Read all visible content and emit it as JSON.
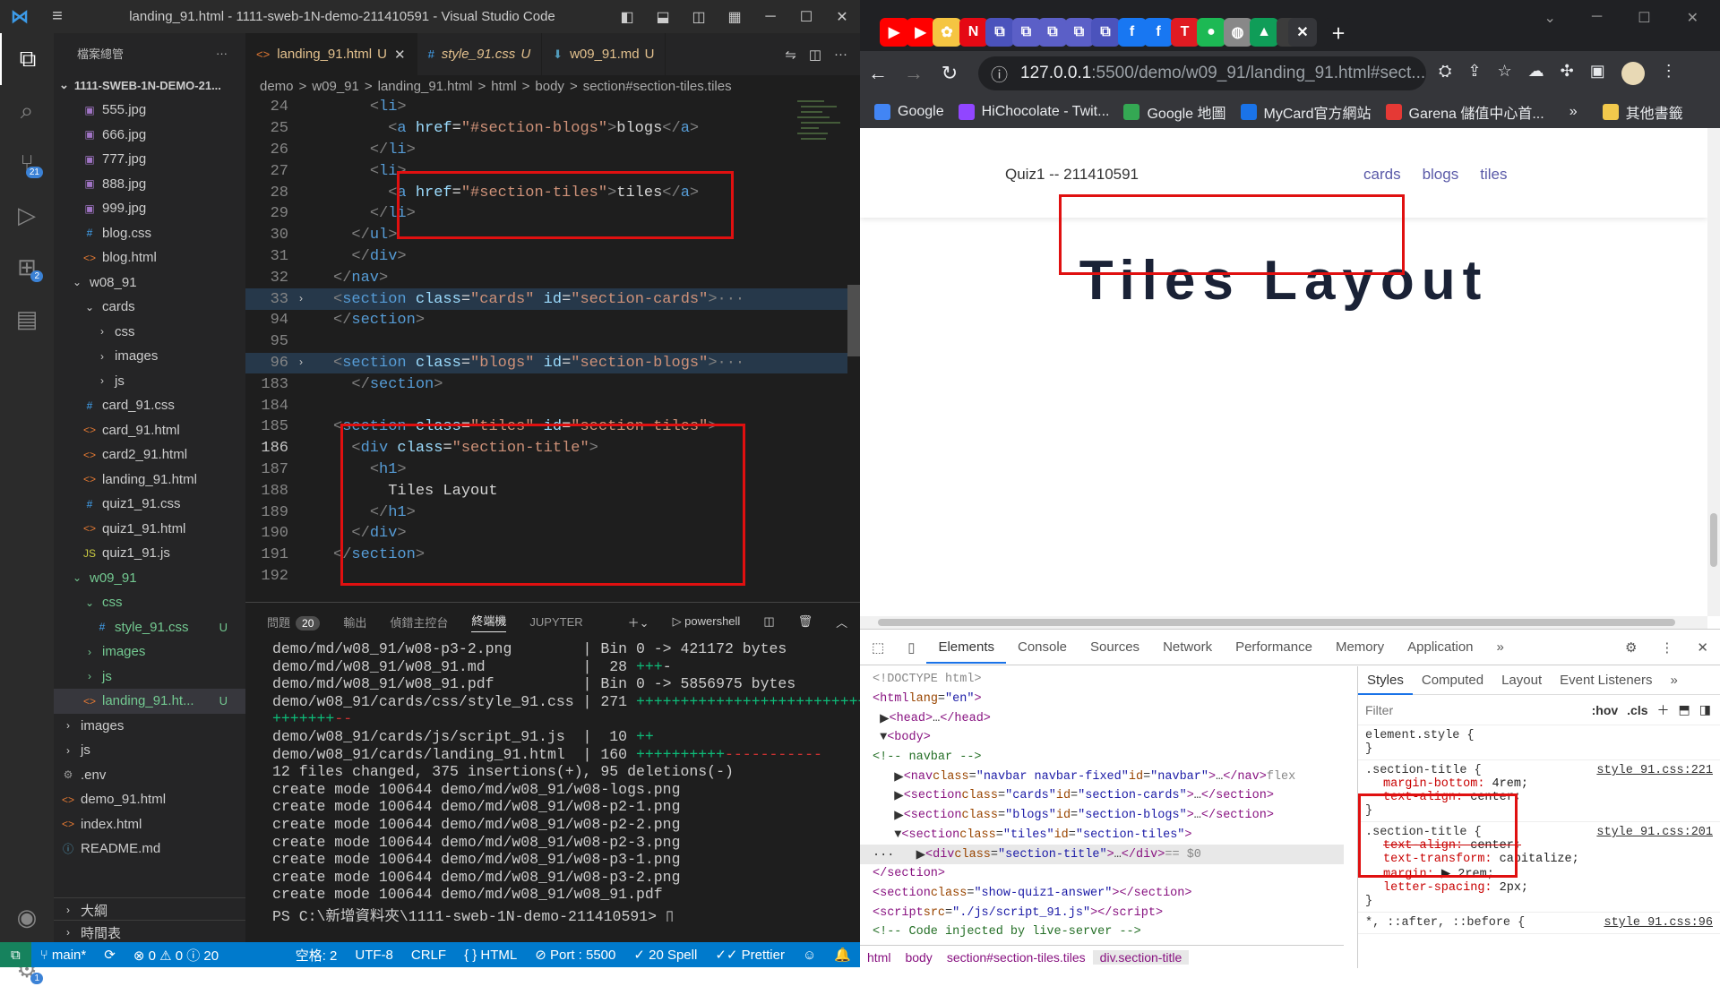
{
  "vscode": {
    "window_title": "landing_91.html - 1111-sweb-1N-demo-211410591 - Visual Studio Code",
    "activity": {
      "scm_badge": "21",
      "ext_badge": "2",
      "settings_badge": "1"
    },
    "explorer": {
      "header": "檔案總管",
      "more": "···",
      "root": "1111-SWEB-1N-DEMO-21...",
      "items": [
        {
          "label": "555.jpg",
          "icon": "img"
        },
        {
          "label": "666.jpg",
          "icon": "img"
        },
        {
          "label": "777.jpg",
          "icon": "img"
        },
        {
          "label": "888.jpg",
          "icon": "img"
        },
        {
          "label": "999.jpg",
          "icon": "img"
        },
        {
          "label": "blog.css",
          "icon": "css"
        },
        {
          "label": "blog.html",
          "icon": "html"
        },
        {
          "label": "w08_91",
          "icon": "folder-open"
        },
        {
          "label": "cards",
          "icon": "folder-open"
        },
        {
          "label": "css",
          "icon": "folder"
        },
        {
          "label": "images",
          "icon": "folder"
        },
        {
          "label": "js",
          "icon": "folder"
        },
        {
          "label": "card_91.css",
          "icon": "css"
        },
        {
          "label": "card_91.html",
          "icon": "html"
        },
        {
          "label": "card2_91.html",
          "icon": "html"
        },
        {
          "label": "landing_91.html",
          "icon": "html"
        },
        {
          "label": "quiz1_91.css",
          "icon": "css"
        },
        {
          "label": "quiz1_91.html",
          "icon": "html"
        },
        {
          "label": "quiz1_91.js",
          "icon": "js"
        },
        {
          "label": "w09_91",
          "icon": "folder-open"
        },
        {
          "label": "css",
          "icon": "folder-open"
        },
        {
          "label": "style_91.css",
          "icon": "css",
          "status": "U"
        },
        {
          "label": "images",
          "icon": "folder"
        },
        {
          "label": "js",
          "icon": "folder"
        },
        {
          "label": "landing_91.ht...",
          "icon": "html",
          "status": "U"
        },
        {
          "label": "images",
          "icon": "folder"
        },
        {
          "label": "js",
          "icon": "folder"
        },
        {
          "label": ".env",
          "icon": "env"
        },
        {
          "label": "demo_91.html",
          "icon": "html"
        },
        {
          "label": "index.html",
          "icon": "html"
        },
        {
          "label": "README.md",
          "icon": "md"
        }
      ],
      "outline": "大綱",
      "timeline": "時間表"
    },
    "tabs": [
      {
        "label": "landing_91.html",
        "status": "U"
      },
      {
        "label": "style_91.css",
        "status": "U"
      },
      {
        "label": "w09_91.md",
        "status": "U"
      }
    ],
    "breadcrumb": [
      "demo",
      ">",
      "w09_91",
      ">",
      "landing_91.html",
      ">",
      "html",
      ">",
      "body",
      ">",
      "section#section-tiles.tiles"
    ],
    "code_lines": [
      {
        "ln": "24",
        "html": "    <span class='pu'>&lt;</span><span class='tg'>li</span><span class='pu'>&gt;</span>"
      },
      {
        "ln": "25",
        "html": "      <span class='pu'>&lt;</span><span class='tg'>a</span> <span class='at'>href</span>=<span class='sv'>\"#section-blogs\"</span><span class='pu'>&gt;</span>blogs<span class='pu'>&lt;/</span><span class='tg'>a</span><span class='pu'>&gt;</span>"
      },
      {
        "ln": "26",
        "html": "    <span class='pu'>&lt;/</span><span class='tg'>li</span><span class='pu'>&gt;</span>"
      },
      {
        "ln": "27",
        "html": "    <span class='pu'>&lt;</span><span class='tg'>li</span><span class='pu'>&gt;</span>"
      },
      {
        "ln": "28",
        "html": "      <span class='pu'>&lt;</span><span class='tg'>a</span> <span class='at'>href</span>=<span class='sv'>\"#section-tiles\"</span><span class='pu'>&gt;</span>tiles<span class='pu'>&lt;/</span><span class='tg'>a</span><span class='pu'>&gt;</span>"
      },
      {
        "ln": "29",
        "html": "    <span class='pu'>&lt;/</span><span class='tg'>li</span><span class='pu'>&gt;</span>"
      },
      {
        "ln": "30",
        "html": "  <span class='pu'>&lt;/</span><span class='tg'>ul</span><span class='pu'>&gt;</span>"
      },
      {
        "ln": "31",
        "html": "  <span class='pu'>&lt;/</span><span class='tg'>div</span><span class='pu'>&gt;</span>"
      },
      {
        "ln": "32",
        "html": "<span class='pu'>&lt;/</span><span class='tg'>nav</span><span class='pu'>&gt;</span>"
      },
      {
        "ln": "33",
        "html": "<span class='pu'>&lt;</span><span class='tg'>section</span> <span class='at'>class</span>=<span class='sv'>\"cards\"</span> <span class='at'>id</span>=<span class='sv'>\"section-cards\"</span><span class='pu'>&gt;</span><span class='pu'>···</span>",
        "fold": "›",
        "hl": true
      },
      {
        "ln": "94",
        "html": "<span class='pu'>&lt;/</span><span class='tg'>section</span><span class='pu'>&gt;</span>"
      },
      {
        "ln": "95",
        "html": ""
      },
      {
        "ln": "96",
        "html": "<span class='pu'>&lt;</span><span class='tg'>section</span> <span class='at'>class</span>=<span class='sv'>\"blogs\"</span> <span class='at'>id</span>=<span class='sv'>\"section-blogs\"</span><span class='pu'>&gt;</span><span class='pu'>···</span>",
        "fold": "›",
        "hl": true
      },
      {
        "ln": "183",
        "html": "  <span class='pu'>&lt;/</span><span class='tg'>section</span><span class='pu'>&gt;</span>"
      },
      {
        "ln": "184",
        "html": ""
      },
      {
        "ln": "185",
        "html": "<span class='pu'>&lt;</span><span class='tg'>section</span> <span class='at'>class</span>=<span class='sv'>\"tiles\"</span> <span class='at'>id</span>=<span class='sv'>\"section-tiles\"</span><span class='pu'>&gt;</span>"
      },
      {
        "ln": "186",
        "html": "  <span class='pu'>&lt;</span><span class='tg'>div</span> <span class='at'>class</span>=<span class='sv'>\"section-title\"</span><span class='pu'>&gt;</span>",
        "cur": true
      },
      {
        "ln": "187",
        "html": "    <span class='pu'>&lt;</span><span class='tg'>h1</span><span class='pu'>&gt;</span>"
      },
      {
        "ln": "188",
        "html": "      Tiles Layout"
      },
      {
        "ln": "189",
        "html": "    <span class='pu'>&lt;/</span><span class='tg'>h1</span><span class='pu'>&gt;</span>"
      },
      {
        "ln": "190",
        "html": "  <span class='pu'>&lt;/</span><span class='tg'>div</span><span class='pu'>&gt;</span>"
      },
      {
        "ln": "191",
        "html": "<span class='pu'>&lt;/</span><span class='tg'>section</span><span class='pu'>&gt;</span>"
      },
      {
        "ln": "192",
        "html": ""
      }
    ],
    "panel": {
      "tabs": [
        "問題",
        "輸出",
        "偵錯主控台",
        "終端機",
        "JUPYTER"
      ],
      "problem_count": "20",
      "shell": "powershell",
      "terminal": [
        {
          "html": "demo/md/w08_91/w08-p3-2.png        | Bin 0 -> 421172 bytes"
        },
        {
          "html": "demo/md/w08_91/w08_91.md           |  28 <span class='grn'>+++</span>-"
        },
        {
          "html": "demo/md/w08_91/w08_91.pdf          | Bin 0 -> 5856975 bytes"
        },
        {
          "html": "demo/w08_91/cards/css/style_91.css | 271 <span class='grn'>+++++++++++++++++++++++++++++++</span>"
        },
        {
          "html": "<span class='grn'>+++++++</span><span class='red'>--</span>"
        },
        {
          "html": "demo/w08_91/cards/js/script_91.js  |  10 <span class='grn'>++</span>"
        },
        {
          "html": "demo/w08_91/cards/landing_91.html  | 160 <span class='grn'>++++++++++</span><span class='red'>-----------</span>"
        },
        {
          "html": "12 files changed, 375 insertions(+), 95 deletions(-)"
        },
        {
          "html": "create mode 100644 demo/md/w08_91/w08-logs.png"
        },
        {
          "html": "create mode 100644 demo/md/w08_91/w08-p2-1.png"
        },
        {
          "html": "create mode 100644 demo/md/w08_91/w08-p2-2.png"
        },
        {
          "html": "create mode 100644 demo/md/w08_91/w08-p2-3.png"
        },
        {
          "html": "create mode 100644 demo/md/w08_91/w08-p3-1.png"
        },
        {
          "html": "create mode 100644 demo/md/w08_91/w08-p3-2.png"
        },
        {
          "html": "create mode 100644 demo/md/w08_91/w08_91.pdf"
        },
        {
          "html": "PS C:\\新增資料夾\\1111-sweb-1N-demo-211410591> ▯"
        }
      ]
    },
    "status": {
      "branch": "main*",
      "sync": "⟳",
      "problems": "⊗ 0 ⚠ 0 ⓘ 20",
      "spaces": "空格: 2",
      "encoding": "UTF-8",
      "eol": "CRLF",
      "language": "{ } HTML",
      "port": "⊘ Port : 5500",
      "spell": "✓ 20 Spell",
      "prettier": "✓✓ Prettier"
    }
  },
  "chrome": {
    "tab_colors": [
      "#ff0000",
      "#ff0000",
      "#f5c542",
      "#e50914",
      "#4b53bc",
      "#5b5fc7",
      "#5b5fc7",
      "#5b5fc7",
      "#4b53bc",
      "#1877f2",
      "#1877f2",
      "#e01b22",
      "#1db954",
      "#888888",
      "#0f9d58",
      "#3c3c3c"
    ],
    "url_host": "127.0.0.1",
    "url_path": ":5500/demo/w09_91/landing_91.html#sect...",
    "bookmarks": [
      {
        "label": "Google",
        "color": "#4285f4"
      },
      {
        "label": "HiChocolate - Twit...",
        "color": "#9146ff"
      },
      {
        "label": "Google 地圖",
        "color": "#34a853"
      },
      {
        "label": "MyCard官方網站",
        "color": "#1a73e8"
      },
      {
        "label": "Garena 儲值中心首...",
        "color": "#e53935"
      }
    ],
    "bookmarks_more": "»",
    "other_bookmarks": "其他書籤",
    "page": {
      "brand": "Quiz1 -- 211410591",
      "nav_links": [
        "cards",
        "blogs",
        "tiles"
      ],
      "heading": "Tiles Layout"
    },
    "devtools": {
      "tabs": [
        "Elements",
        "Console",
        "Sources",
        "Network",
        "Performance",
        "Memory",
        "Application",
        "»"
      ],
      "elements": [
        {
          "html": "<span class='eg'>&lt;!DOCTYPE html&gt;</span>"
        },
        {
          "html": "<span class='et'>&lt;html</span> <span class='ea'>lang</span>=<span class='ev'>\"en\"</span><span class='et'>&gt;</span>"
        },
        {
          "html": " ▶<span class='et'>&lt;head&gt;</span>…<span class='et'>&lt;/head&gt;</span>"
        },
        {
          "html": " ▼<span class='et'>&lt;body&gt;</span>"
        },
        {
          "html": "    <span class='ec'>&lt;!-- navbar --&gt;</span>"
        },
        {
          "html": "   ▶<span class='et'>&lt;nav</span> <span class='ea'>class</span>=<span class='ev'>\"navbar navbar-fixed\"</span> <span class='ea'>id</span>=<span class='ev'>\"navbar\"</span><span class='et'>&gt;</span>…<span class='et'>&lt;/nav&gt;</span> <span class='eg'>flex</span>"
        },
        {
          "html": "   ▶<span class='et'>&lt;section</span> <span class='ea'>class</span>=<span class='ev'>\"cards\"</span> <span class='ea'>id</span>=<span class='ev'>\"section-cards\"</span><span class='et'>&gt;</span>…<span class='et'>&lt;/section&gt;</span>"
        },
        {
          "html": "   ▶<span class='et'>&lt;section</span> <span class='ea'>class</span>=<span class='ev'>\"blogs\"</span> <span class='ea'>id</span>=<span class='ev'>\"section-blogs\"</span><span class='et'>&gt;</span>…<span class='et'>&lt;/section&gt;</span>"
        },
        {
          "html": "   ▼<span class='et'>&lt;section</span> <span class='ea'>class</span>=<span class='ev'>\"tiles\"</span> <span class='ea'>id</span>=<span class='ev'>\"section-tiles\"</span><span class='et'>&gt;</span>"
        },
        {
          "html": "···   ▶<span class='et'>&lt;div</span> <span class='ea'>class</span>=<span class='ev'>\"section-title\"</span><span class='et'>&gt;</span>…<span class='et'>&lt;/div&gt;</span> <span class='eg'>== $0</span>",
          "sel": true
        },
        {
          "html": "    <span class='et'>&lt;/section&gt;</span>"
        },
        {
          "html": "    <span class='et'>&lt;section</span> <span class='ea'>class</span>=<span class='ev'>\"show-quiz1-answer\"</span><span class='et'>&gt;&lt;/section&gt;</span>"
        },
        {
          "html": "    <span class='et'>&lt;script</span> <span class='ea'>src</span>=<span class='ev'>\"./js/script_91.js\"</span><span class='et'>&gt;&lt;/script&gt;</span>"
        },
        {
          "html": "    <span class='ec'>&lt;!-- Code injected by live-server --&gt;</span>"
        }
      ],
      "crumbs": [
        "html",
        "body",
        "section#section-tiles.tiles",
        "div.section-title"
      ],
      "side_tabs": [
        "Styles",
        "Computed",
        "Layout",
        "Event Listeners",
        "»"
      ],
      "filter_placeholder": "Filter",
      "hov": ":hov",
      "cls": ".cls",
      "element_style": "element.style {",
      "rule1": {
        "selector": ".section-title {",
        "source": "style_91.css:221",
        "props": [
          [
            "margin-bottom",
            "4rem;"
          ],
          [
            "text-align",
            "center;"
          ]
        ]
      },
      "rule2": {
        "selector": ".section-title {",
        "source": "style_91.css:201",
        "props": [
          [
            "text-align",
            "center;"
          ],
          [
            "text-transform",
            "capitalize;"
          ],
          [
            "margin",
            "▶ 2rem;"
          ],
          [
            "letter-spacing",
            "2px;"
          ]
        ]
      },
      "rule3": {
        "selector": "*, ::after, ::before {",
        "source": "style_91.css:96"
      }
    }
  }
}
